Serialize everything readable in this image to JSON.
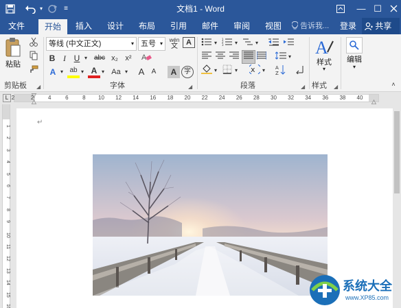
{
  "titlebar": {
    "title": "文档1 - Word",
    "undo_icon": "undo-icon",
    "redo_icon": "redo-icon",
    "customize_icon": "customize-qat-icon",
    "ribbon_display_icon": "ribbon-display-icon",
    "minimize_glyph": "—",
    "maximize_glyph": "☐"
  },
  "tabs": [
    {
      "label": "文件"
    },
    {
      "label": "开始"
    },
    {
      "label": "插入"
    },
    {
      "label": "设计"
    },
    {
      "label": "布局"
    },
    {
      "label": "引用"
    },
    {
      "label": "邮件"
    },
    {
      "label": "审阅"
    },
    {
      "label": "视图"
    }
  ],
  "tell_me": "告诉我...",
  "login": "登录",
  "share": "共享",
  "ribbon": {
    "paste_label": "粘贴",
    "clipboard_label": "剪贴板",
    "font_name": "等线 (中文正文)",
    "font_size": "五号",
    "font_group_label": "字体",
    "paragraph_label": "段落",
    "style_button": "样式",
    "style_label": "样式",
    "edit_button": "编辑",
    "bold": "B",
    "italic": "I",
    "underline": "U",
    "strike": "abc",
    "subscript": "x₂",
    "superscript": "x²",
    "font_color_glyph": "A",
    "change_case": "Aa",
    "grow": "A",
    "shrink": "A",
    "char_shade": "A",
    "phonetic": "字",
    "clear_format_glyph": "A",
    "wen": "wén",
    "wen_char": "文",
    "text_effect": "A",
    "highlight": "ab",
    "enclose": "字"
  },
  "ruler": {
    "numbers": [
      "2",
      "2",
      "4",
      "6",
      "8",
      "10",
      "12",
      "14",
      "16",
      "18",
      "20",
      "22",
      "24",
      "26",
      "28",
      "30",
      "32",
      "34",
      "36",
      "38",
      "40"
    ]
  },
  "vruler": {
    "numbers": [
      "1",
      "2",
      "3",
      "4",
      "5",
      "6",
      "7",
      "8",
      "9",
      "10",
      "11",
      "12",
      "13",
      "14",
      "15",
      "16"
    ]
  },
  "watermark": {
    "text": "系统大全",
    "url": "www.XP85.com"
  },
  "colors": {
    "accent": "#2b579a",
    "ribbon_bg": "#f3f3f3",
    "page_bg": "#ffffff",
    "highlight_yellow": "#ffff00",
    "font_red": "#e02020"
  }
}
